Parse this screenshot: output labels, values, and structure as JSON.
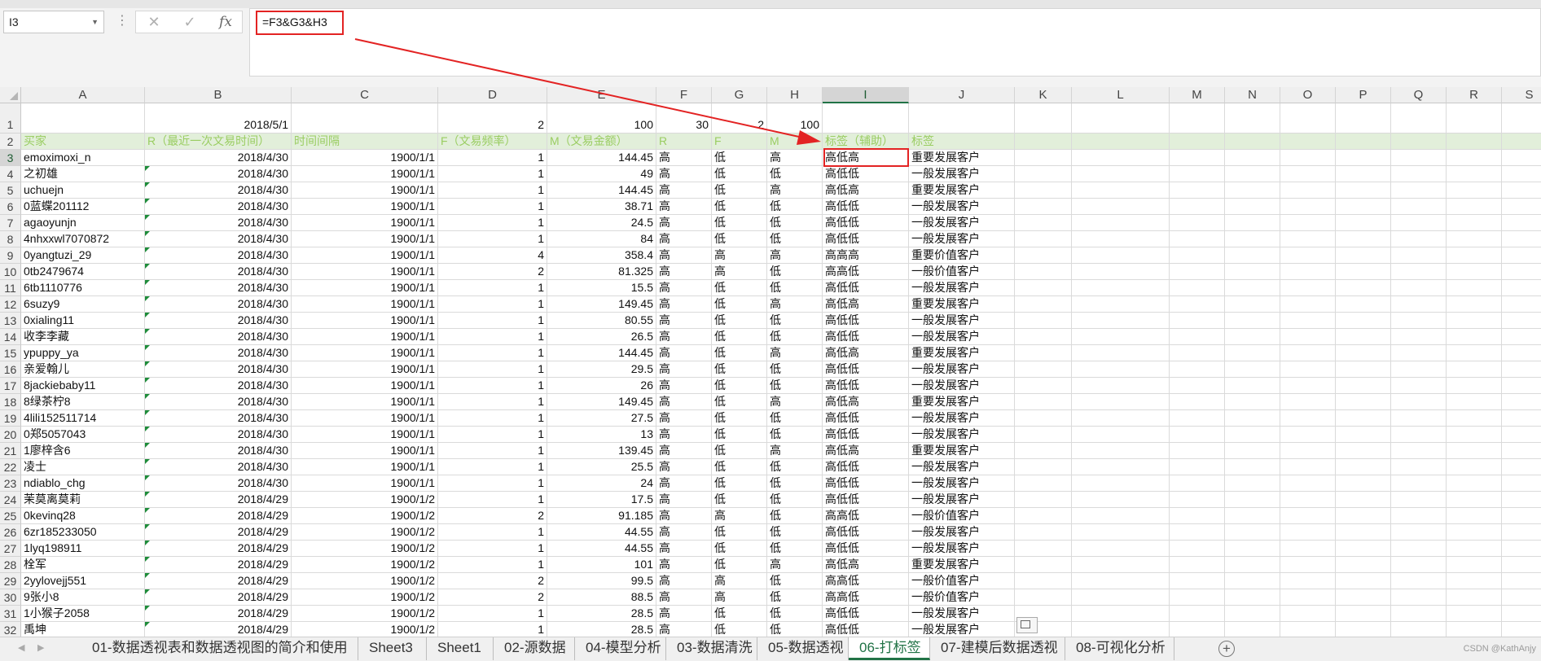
{
  "namebox": {
    "value": "I3"
  },
  "formula_bar": {
    "formula": "=F3&G3&H3",
    "cancel_symbol": "✕",
    "enter_symbol": "✓",
    "fx_label": "fx",
    "dots": "⋮"
  },
  "columns": [
    "A",
    "B",
    "C",
    "D",
    "E",
    "F",
    "G",
    "H",
    "I",
    "J",
    "K",
    "L",
    "M",
    "N",
    "O",
    "P",
    "Q",
    "R",
    "S"
  ],
  "selected_column": "I",
  "selected_row": 3,
  "row1": {
    "B": "2018/5/1",
    "D": "2",
    "E": "100",
    "F": "30",
    "G": "2",
    "H": "100"
  },
  "row2": {
    "A": "买家",
    "B": "R（最近一次文易时间）",
    "C": "时间间隔",
    "D": "F（文易频率）",
    "E": "M（文易金额）",
    "F": "R",
    "G": "F",
    "H": "M",
    "I": "标签（辅助）",
    "J": "标签"
  },
  "rows": [
    {
      "n": 3,
      "A": "emoximoxi_n",
      "B": "2018/4/30",
      "C": "1900/1/1",
      "D": "1",
      "E": "144.45",
      "F": "高",
      "G": "低",
      "H": "高",
      "I": "高低高",
      "J": "重要发展客户"
    },
    {
      "n": 4,
      "A": "之初雄",
      "B": "2018/4/30",
      "C": "1900/1/1",
      "D": "1",
      "E": "49",
      "F": "高",
      "G": "低",
      "H": "低",
      "I": "高低低",
      "J": "一般发展客户"
    },
    {
      "n": 5,
      "A": "uchuejn",
      "B": "2018/4/30",
      "C": "1900/1/1",
      "D": "1",
      "E": "144.45",
      "F": "高",
      "G": "低",
      "H": "高",
      "I": "高低高",
      "J": "重要发展客户"
    },
    {
      "n": 6,
      "A": "0蓝蝶201112",
      "B": "2018/4/30",
      "C": "1900/1/1",
      "D": "1",
      "E": "38.71",
      "F": "高",
      "G": "低",
      "H": "低",
      "I": "高低低",
      "J": "一般发展客户"
    },
    {
      "n": 7,
      "A": "agaoyunjn",
      "B": "2018/4/30",
      "C": "1900/1/1",
      "D": "1",
      "E": "24.5",
      "F": "高",
      "G": "低",
      "H": "低",
      "I": "高低低",
      "J": "一般发展客户"
    },
    {
      "n": 8,
      "A": "4nhxxwl7070872",
      "B": "2018/4/30",
      "C": "1900/1/1",
      "D": "1",
      "E": "84",
      "F": "高",
      "G": "低",
      "H": "低",
      "I": "高低低",
      "J": "一般发展客户"
    },
    {
      "n": 9,
      "A": "0yangtuzi_29",
      "B": "2018/4/30",
      "C": "1900/1/1",
      "D": "4",
      "E": "358.4",
      "F": "高",
      "G": "高",
      "H": "高",
      "I": "高高高",
      "J": "重要价值客户"
    },
    {
      "n": 10,
      "A": "0tb2479674",
      "B": "2018/4/30",
      "C": "1900/1/1",
      "D": "2",
      "E": "81.325",
      "F": "高",
      "G": "高",
      "H": "低",
      "I": "高高低",
      "J": "一般价值客户"
    },
    {
      "n": 11,
      "A": "6tb1110776",
      "B": "2018/4/30",
      "C": "1900/1/1",
      "D": "1",
      "E": "15.5",
      "F": "高",
      "G": "低",
      "H": "低",
      "I": "高低低",
      "J": "一般发展客户"
    },
    {
      "n": 12,
      "A": "6suzy9",
      "B": "2018/4/30",
      "C": "1900/1/1",
      "D": "1",
      "E": "149.45",
      "F": "高",
      "G": "低",
      "H": "高",
      "I": "高低高",
      "J": "重要发展客户"
    },
    {
      "n": 13,
      "A": "0xialing11",
      "B": "2018/4/30",
      "C": "1900/1/1",
      "D": "1",
      "E": "80.55",
      "F": "高",
      "G": "低",
      "H": "低",
      "I": "高低低",
      "J": "一般发展客户"
    },
    {
      "n": 14,
      "A": "收李李藏",
      "B": "2018/4/30",
      "C": "1900/1/1",
      "D": "1",
      "E": "26.5",
      "F": "高",
      "G": "低",
      "H": "低",
      "I": "高低低",
      "J": "一般发展客户"
    },
    {
      "n": 15,
      "A": "ypuppy_ya",
      "B": "2018/4/30",
      "C": "1900/1/1",
      "D": "1",
      "E": "144.45",
      "F": "高",
      "G": "低",
      "H": "高",
      "I": "高低高",
      "J": "重要发展客户"
    },
    {
      "n": 16,
      "A": "亲爱翰儿",
      "B": "2018/4/30",
      "C": "1900/1/1",
      "D": "1",
      "E": "29.5",
      "F": "高",
      "G": "低",
      "H": "低",
      "I": "高低低",
      "J": "一般发展客户"
    },
    {
      "n": 17,
      "A": "8jackiebaby11",
      "B": "2018/4/30",
      "C": "1900/1/1",
      "D": "1",
      "E": "26",
      "F": "高",
      "G": "低",
      "H": "低",
      "I": "高低低",
      "J": "一般发展客户"
    },
    {
      "n": 18,
      "A": "8绿茶柠8",
      "B": "2018/4/30",
      "C": "1900/1/1",
      "D": "1",
      "E": "149.45",
      "F": "高",
      "G": "低",
      "H": "高",
      "I": "高低高",
      "J": "重要发展客户"
    },
    {
      "n": 19,
      "A": "4lili152511714",
      "B": "2018/4/30",
      "C": "1900/1/1",
      "D": "1",
      "E": "27.5",
      "F": "高",
      "G": "低",
      "H": "低",
      "I": "高低低",
      "J": "一般发展客户"
    },
    {
      "n": 20,
      "A": "0郑5057043",
      "B": "2018/4/30",
      "C": "1900/1/1",
      "D": "1",
      "E": "13",
      "F": "高",
      "G": "低",
      "H": "低",
      "I": "高低低",
      "J": "一般发展客户"
    },
    {
      "n": 21,
      "A": "1廖梓含6",
      "B": "2018/4/30",
      "C": "1900/1/1",
      "D": "1",
      "E": "139.45",
      "F": "高",
      "G": "低",
      "H": "高",
      "I": "高低高",
      "J": "重要发展客户"
    },
    {
      "n": 22,
      "A": "凌士",
      "B": "2018/4/30",
      "C": "1900/1/1",
      "D": "1",
      "E": "25.5",
      "F": "高",
      "G": "低",
      "H": "低",
      "I": "高低低",
      "J": "一般发展客户"
    },
    {
      "n": 23,
      "A": "ndiablo_chg",
      "B": "2018/4/30",
      "C": "1900/1/1",
      "D": "1",
      "E": "24",
      "F": "高",
      "G": "低",
      "H": "低",
      "I": "高低低",
      "J": "一般发展客户"
    },
    {
      "n": 24,
      "A": "茉莫离莫莉",
      "B": "2018/4/29",
      "C": "1900/1/2",
      "D": "1",
      "E": "17.5",
      "F": "高",
      "G": "低",
      "H": "低",
      "I": "高低低",
      "J": "一般发展客户"
    },
    {
      "n": 25,
      "A": "0kevinq28",
      "B": "2018/4/29",
      "C": "1900/1/2",
      "D": "2",
      "E": "91.185",
      "F": "高",
      "G": "高",
      "H": "低",
      "I": "高高低",
      "J": "一般价值客户"
    },
    {
      "n": 26,
      "A": "6zr185233050",
      "B": "2018/4/29",
      "C": "1900/1/2",
      "D": "1",
      "E": "44.55",
      "F": "高",
      "G": "低",
      "H": "低",
      "I": "高低低",
      "J": "一般发展客户"
    },
    {
      "n": 27,
      "A": "1lyq198911",
      "B": "2018/4/29",
      "C": "1900/1/2",
      "D": "1",
      "E": "44.55",
      "F": "高",
      "G": "低",
      "H": "低",
      "I": "高低低",
      "J": "一般发展客户"
    },
    {
      "n": 28,
      "A": "栓军",
      "B": "2018/4/29",
      "C": "1900/1/2",
      "D": "1",
      "E": "101",
      "F": "高",
      "G": "低",
      "H": "高",
      "I": "高低高",
      "J": "重要发展客户"
    },
    {
      "n": 29,
      "A": "2yylovejj551",
      "B": "2018/4/29",
      "C": "1900/1/2",
      "D": "2",
      "E": "99.5",
      "F": "高",
      "G": "高",
      "H": "低",
      "I": "高高低",
      "J": "一般价值客户"
    },
    {
      "n": 30,
      "A": "9张小8",
      "B": "2018/4/29",
      "C": "1900/1/2",
      "D": "2",
      "E": "88.5",
      "F": "高",
      "G": "高",
      "H": "低",
      "I": "高高低",
      "J": "一般价值客户"
    },
    {
      "n": 31,
      "A": "1小猴子2058",
      "B": "2018/4/29",
      "C": "1900/1/2",
      "D": "1",
      "E": "28.5",
      "F": "高",
      "G": "低",
      "H": "低",
      "I": "高低低",
      "J": "一般发展客户"
    },
    {
      "n": 32,
      "A": "禹坤",
      "B": "2018/4/29",
      "C": "1900/1/2",
      "D": "1",
      "E": "28.5",
      "F": "高",
      "G": "低",
      "H": "低",
      "I": "高低低",
      "J": "一般发展客户"
    }
  ],
  "tabs": [
    {
      "label": "01-数据透视表和数据透视图的简介和使用",
      "active": false
    },
    {
      "label": "Sheet3",
      "active": false
    },
    {
      "label": "Sheet1",
      "active": false
    },
    {
      "label": "02-源数据",
      "active": false
    },
    {
      "label": "04-模型分析",
      "active": false
    },
    {
      "label": "03-数据清洗",
      "active": false
    },
    {
      "label": "05-数据透视",
      "active": false
    },
    {
      "label": "06-打标签",
      "active": true
    },
    {
      "label": "07-建模后数据透视",
      "active": false
    },
    {
      "label": "08-可视化分析",
      "active": false
    }
  ],
  "watermark": "CSDN @KathAnjy",
  "colors": {
    "accent": "#217346",
    "highlight_red": "#e32323",
    "header_row_fill": "#e2efda",
    "header_row_text": "#9acd62"
  }
}
